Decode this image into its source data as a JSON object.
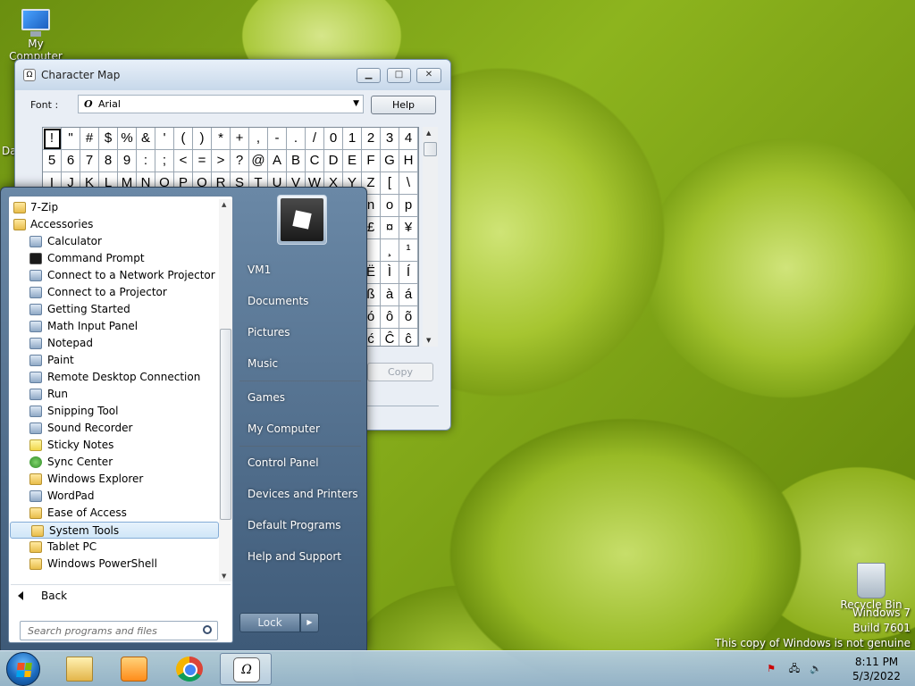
{
  "desktop": {
    "my_computer_label": "My Computer",
    "da_label": "Da",
    "recycle_bin_label": "Recycle Bin",
    "watermark": {
      "line1": "Windows 7",
      "line2": "Build 7601",
      "line3": "This copy of Windows is not genuine"
    }
  },
  "charmap": {
    "title": "Character Map",
    "font_label": "Font :",
    "font_value": "Arial",
    "font_icon": "O",
    "help_label": "Help",
    "copy_label": "Copy",
    "rows": [
      [
        "!",
        "\"",
        "#",
        "$",
        "%",
        "&",
        "'",
        "(",
        ")",
        "*",
        "+",
        ",",
        "-",
        ".",
        "/",
        "0",
        "1",
        "2",
        "3",
        "4"
      ],
      [
        "5",
        "6",
        "7",
        "8",
        "9",
        ":",
        ";",
        "<",
        "=",
        ">",
        "?",
        "@",
        "A",
        "B",
        "C",
        "D",
        "E",
        "F",
        "G",
        "H"
      ],
      [
        "I",
        "J",
        "K",
        "L",
        "M",
        "N",
        "O",
        "P",
        "Q",
        "R",
        "S",
        "T",
        "U",
        "V",
        "W",
        "X",
        "Y",
        "Z",
        "[",
        "\\"
      ],
      [
        "",
        "",
        "",
        "",
        "",
        "",
        "",
        "",
        "",
        "",
        "",
        "",
        "",
        "",
        "",
        "",
        "",
        "n",
        "o",
        "p"
      ],
      [
        "",
        "",
        "",
        "",
        "",
        "",
        "",
        "",
        "",
        "",
        "",
        "",
        "",
        "",
        "",
        "",
        "",
        "£",
        "¤",
        "¥"
      ],
      [
        "",
        "",
        "",
        "",
        "",
        "",
        "",
        "",
        "",
        "",
        "",
        "",
        "",
        "",
        "",
        "",
        "",
        "",
        "¸",
        "¹"
      ],
      [
        "",
        "",
        "",
        "",
        "",
        "",
        "",
        "",
        "",
        "",
        "",
        "",
        "",
        "",
        "",
        "",
        "",
        "Ë",
        "Ì",
        "Í"
      ],
      [
        "",
        "",
        "",
        "",
        "",
        "",
        "",
        "",
        "",
        "",
        "",
        "",
        "",
        "",
        "",
        "",
        "",
        "ß",
        "à",
        "á"
      ],
      [
        "",
        "",
        "",
        "",
        "",
        "",
        "",
        "",
        "",
        "",
        "",
        "",
        "",
        "",
        "",
        "",
        "",
        "ó",
        "ô",
        "õ"
      ],
      [
        "",
        "",
        "",
        "",
        "",
        "",
        "",
        "",
        "",
        "",
        "",
        "",
        "",
        "",
        "",
        "",
        "",
        "ć",
        "Ĉ",
        "ĉ"
      ]
    ]
  },
  "startmenu": {
    "programs": [
      {
        "label": "7-Zip",
        "level": 0,
        "icon": "folder-icon",
        "style": "folder"
      },
      {
        "label": "Accessories",
        "level": 0,
        "icon": "folder-icon",
        "style": "folder"
      },
      {
        "label": "Calculator",
        "level": 1,
        "icon": "calculator-icon",
        "style": "app"
      },
      {
        "label": "Command Prompt",
        "level": 1,
        "icon": "command-prompt-icon",
        "style": "dark"
      },
      {
        "label": "Connect to a Network Projector",
        "level": 1,
        "icon": "network-projector-icon",
        "style": "app"
      },
      {
        "label": "Connect to a Projector",
        "level": 1,
        "icon": "projector-icon",
        "style": "app"
      },
      {
        "label": "Getting Started",
        "level": 1,
        "icon": "getting-started-icon",
        "style": "app"
      },
      {
        "label": "Math Input Panel",
        "level": 1,
        "icon": "math-input-icon",
        "style": "app"
      },
      {
        "label": "Notepad",
        "level": 1,
        "icon": "notepad-icon",
        "style": "app"
      },
      {
        "label": "Paint",
        "level": 1,
        "icon": "paint-icon",
        "style": "app"
      },
      {
        "label": "Remote Desktop Connection",
        "level": 1,
        "icon": "remote-desktop-icon",
        "style": "app"
      },
      {
        "label": "Run",
        "level": 1,
        "icon": "run-icon",
        "style": "app"
      },
      {
        "label": "Snipping Tool",
        "level": 1,
        "icon": "snipping-tool-icon",
        "style": "app"
      },
      {
        "label": "Sound Recorder",
        "level": 1,
        "icon": "microphone-icon",
        "style": "app"
      },
      {
        "label": "Sticky Notes",
        "level": 1,
        "icon": "sticky-notes-icon",
        "style": "yellow"
      },
      {
        "label": "Sync Center",
        "level": 1,
        "icon": "sync-center-icon",
        "style": "green"
      },
      {
        "label": "Windows Explorer",
        "level": 1,
        "icon": "explorer-icon",
        "style": "folder"
      },
      {
        "label": "WordPad",
        "level": 1,
        "icon": "wordpad-icon",
        "style": "app"
      },
      {
        "label": "Ease of Access",
        "level": 1,
        "icon": "folder-icon",
        "style": "folder"
      },
      {
        "label": "System Tools",
        "level": 1,
        "icon": "folder-icon",
        "style": "folder",
        "highlighted": true
      },
      {
        "label": "Tablet PC",
        "level": 1,
        "icon": "folder-icon",
        "style": "folder"
      },
      {
        "label": "Windows PowerShell",
        "level": 1,
        "icon": "folder-icon",
        "style": "folder"
      }
    ],
    "back_label": "Back",
    "search_placeholder": "Search programs and files",
    "right_items": [
      {
        "label": "VM1"
      },
      {
        "label": "Documents"
      },
      {
        "label": "Pictures"
      },
      {
        "label": "Music"
      },
      {
        "label": "Games"
      },
      {
        "label": "My Computer"
      },
      {
        "label": "Control Panel"
      },
      {
        "label": "Devices and Printers"
      },
      {
        "label": "Default Programs"
      },
      {
        "label": "Help and Support"
      }
    ],
    "lock_label": "Lock",
    "lock_arrow": "▶"
  },
  "taskbar": {
    "pinned": [
      {
        "name": "windows-explorer"
      },
      {
        "name": "windows-media-player"
      },
      {
        "name": "google-chrome"
      },
      {
        "name": "character-map",
        "active": true,
        "glyph": "Ω"
      }
    ],
    "clock_time": "8:11 PM",
    "clock_date": "5/3/2022"
  }
}
